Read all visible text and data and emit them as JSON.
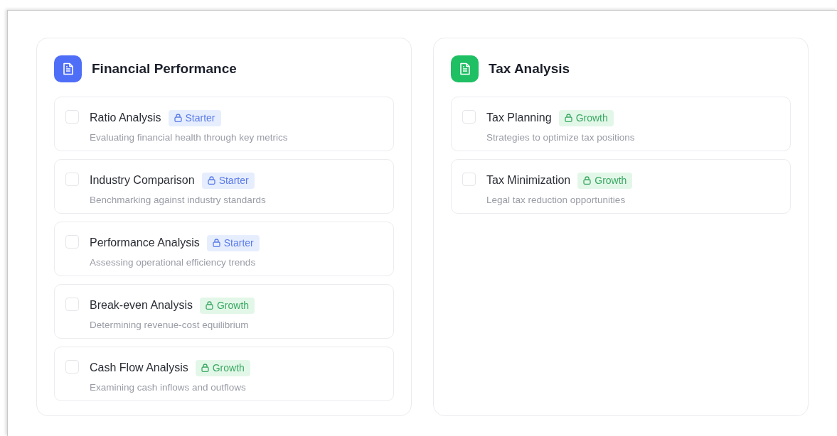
{
  "sections": [
    {
      "title": "Financial Performance",
      "color": "#4f6ef7",
      "items": [
        {
          "title": "Ratio Analysis",
          "checked": false,
          "badge": {
            "kind": "starter",
            "label": "Starter"
          },
          "description": "Evaluating financial health through key metrics"
        },
        {
          "title": "Industry Comparison",
          "checked": false,
          "badge": {
            "kind": "starter",
            "label": "Starter"
          },
          "description": "Benchmarking against industry standards"
        },
        {
          "title": "Performance Analysis",
          "checked": false,
          "badge": {
            "kind": "starter",
            "label": "Starter"
          },
          "description": "Assessing operational efficiency trends"
        },
        {
          "title": "Break-even Analysis",
          "checked": false,
          "badge": {
            "kind": "growth",
            "label": "Growth"
          },
          "description": "Determining revenue-cost equilibrium"
        },
        {
          "title": "Cash Flow Analysis",
          "checked": false,
          "badge": {
            "kind": "growth",
            "label": "Growth"
          },
          "description": "Examining cash inflows and outflows"
        }
      ]
    },
    {
      "title": "Tax Analysis",
      "color": "#1fbf63",
      "items": [
        {
          "title": "Tax Planning",
          "checked": false,
          "badge": {
            "kind": "growth",
            "label": "Growth"
          },
          "description": "Strategies to optimize tax positions"
        },
        {
          "title": "Tax Minimization",
          "checked": false,
          "badge": {
            "kind": "growth",
            "label": "Growth"
          },
          "description": "Legal tax reduction opportunities"
        }
      ]
    }
  ]
}
